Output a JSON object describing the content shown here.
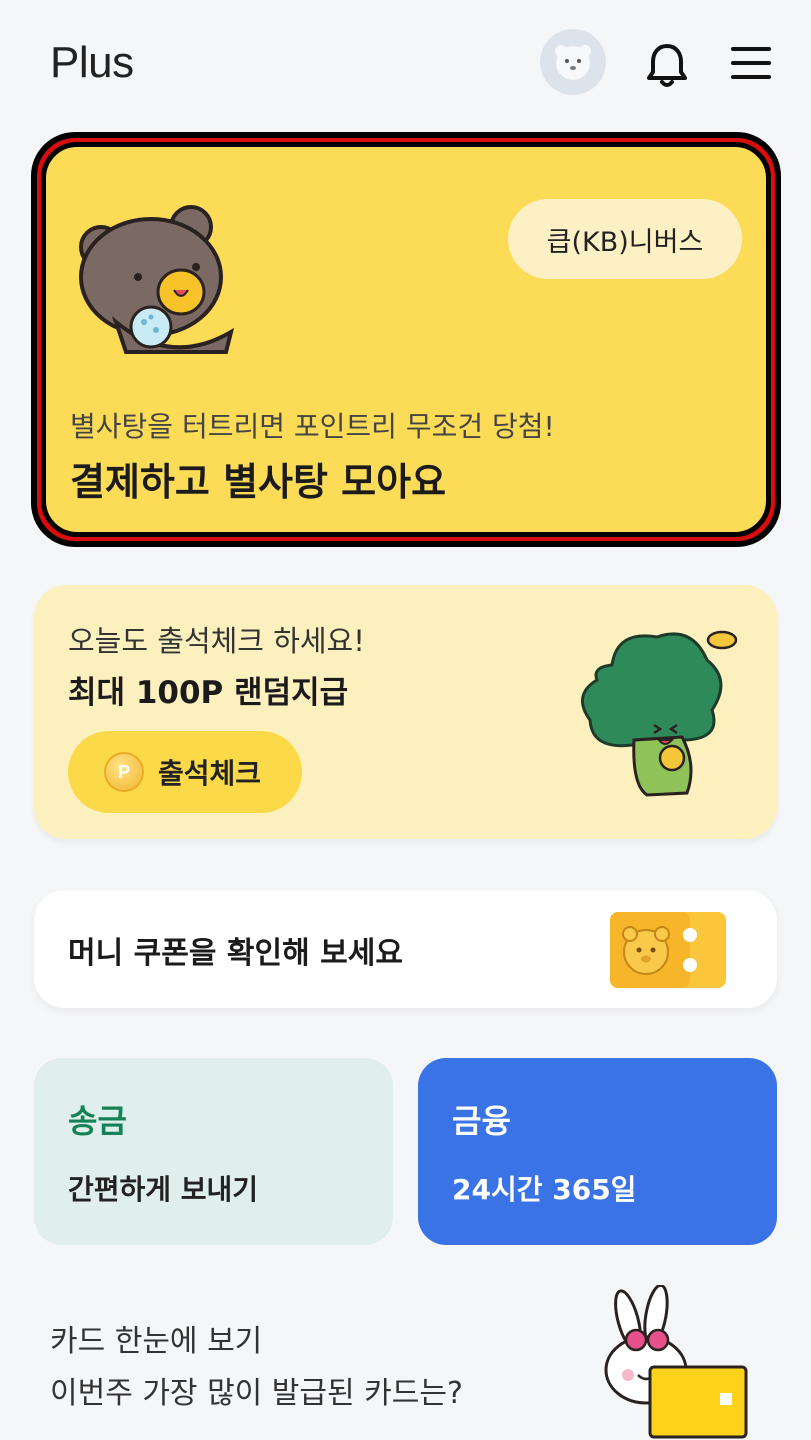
{
  "header": {
    "title": "Plus",
    "icons": [
      "avatar-icon",
      "bell-icon",
      "menu-icon"
    ]
  },
  "promo": {
    "pill_label": "큽(KB)니버스",
    "subtitle": "별사탕을 터트리면 포인트리 무조건 당첨!",
    "title": "결제하고 별사탕 모아요",
    "highlight_color": "#d80d0d",
    "background_color": "#fcdb57"
  },
  "attendance": {
    "subtitle": "오늘도 출석체크 하세요!",
    "title": "최대 100P 랜덤지급",
    "coin_letter": "P",
    "button_label": "출석체크"
  },
  "coupon": {
    "title": "머니 쿠폰을 확인해 보세요"
  },
  "tiles": {
    "transfer": {
      "title": "송금",
      "subtitle": "간편하게 보내기"
    },
    "finance": {
      "title": "금융",
      "subtitle": "24시간 365일"
    }
  },
  "card_section": {
    "line1": "카드 한눈에 보기",
    "line2": "이번주 가장 많이 발급된 카드는?"
  }
}
